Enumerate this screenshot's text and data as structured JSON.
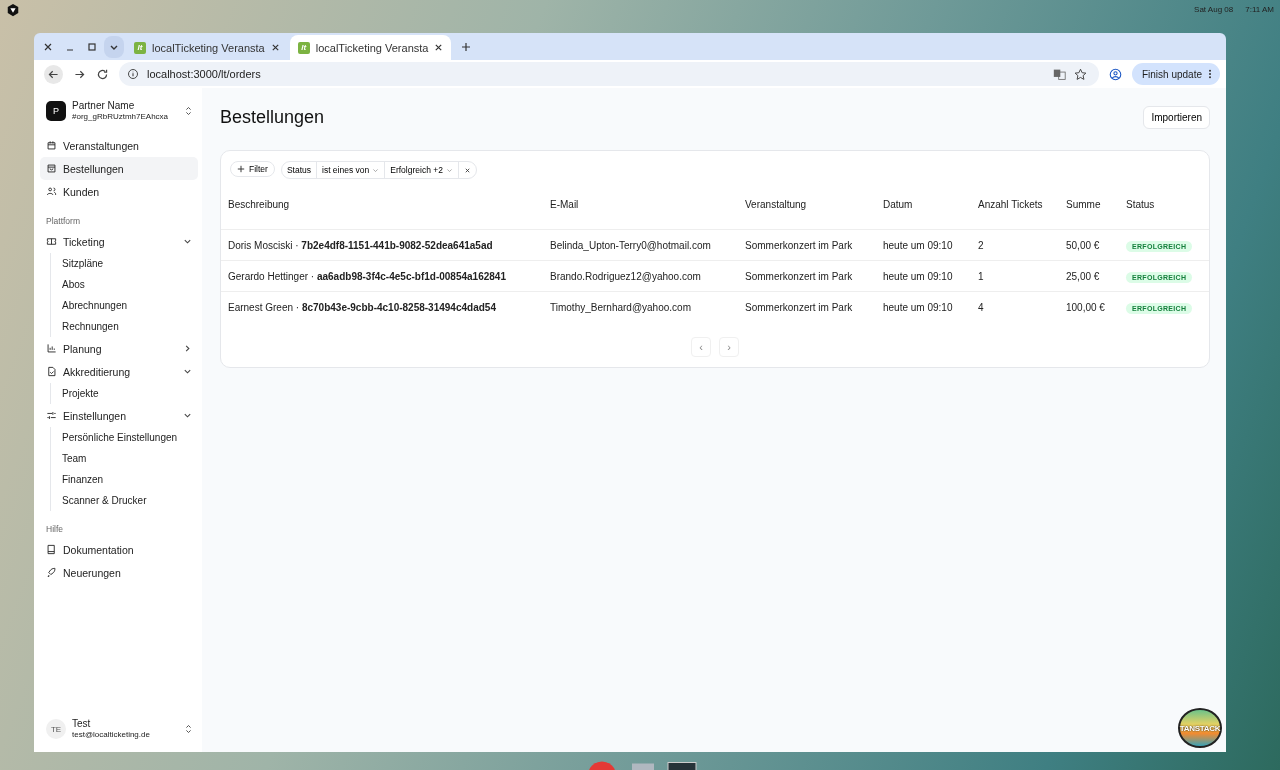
{
  "topbar": {
    "date": "Sat Aug 08",
    "time": "7:11 AM"
  },
  "browser": {
    "tabs": [
      {
        "title": "localTicketing Veransta",
        "favicon": "lt",
        "selected": false
      },
      {
        "title": "localTicketing Veransta",
        "favicon": "lt",
        "selected": true
      }
    ],
    "url": "localhost:3000/lt/orders",
    "update_button": "Finish update"
  },
  "sidebar": {
    "org": {
      "avatar": "P",
      "name": "Partner Name",
      "id": "#org_gRbRUztmh7EAhcxa"
    },
    "items": [
      {
        "label": "Veranstaltungen",
        "selected": false
      },
      {
        "label": "Bestellungen",
        "selected": true
      },
      {
        "label": "Kunden",
        "selected": false
      }
    ],
    "sections": [
      {
        "title": "Plattform",
        "groups": [
          {
            "label": "Ticketing",
            "expanded": true,
            "children": [
              {
                "label": "Sitzpläne"
              },
              {
                "label": "Abos"
              },
              {
                "label": "Abrechnungen"
              },
              {
                "label": "Rechnungen"
              }
            ]
          },
          {
            "label": "Planung",
            "expanded": false
          },
          {
            "label": "Akkreditierung",
            "expanded": true,
            "children": [
              {
                "label": "Projekte"
              }
            ]
          },
          {
            "label": "Einstellungen",
            "expanded": true,
            "children": [
              {
                "label": "Persönliche Einstellungen"
              },
              {
                "label": "Team"
              },
              {
                "label": "Finanzen"
              },
              {
                "label": "Scanner & Drucker"
              }
            ]
          }
        ]
      },
      {
        "title": "Hilfe",
        "groups": [
          {
            "label": "Dokumentation"
          },
          {
            "label": "Neuerungen"
          }
        ]
      }
    ],
    "user": {
      "initials": "TE",
      "name": "Test",
      "email": "test@localticketing.de"
    }
  },
  "page": {
    "title": "Bestellungen",
    "import_button": "Importieren",
    "filter": {
      "add": "Filter",
      "field": "Status",
      "operator": "ist eines von",
      "value": "Erfolgreich +2"
    },
    "table": {
      "columns": [
        "Beschreibung",
        "E-Mail",
        "Veranstaltung",
        "Datum",
        "Anzahl Tickets",
        "Summe",
        "Status"
      ],
      "rows": [
        {
          "description": "Doris Mosciski · **7b2e4df8-1151-441b-9082-52dea641a5ad**",
          "email": "Belinda_Upton-Terry0@hotmail.com",
          "event": "Sommerkonzert im Park",
          "date": "heute um 09:10",
          "tickets": "2",
          "sum": "50,00 €",
          "status": "ERFOLGREICH",
          "color": "#dcfce7"
        },
        {
          "description": "Gerardo Hettinger · **aa6adb98-3f4c-4e5c-bf1d-00854a162841**",
          "email": "Brando.Rodriguez12@yahoo.com",
          "event": "Sommerkonzert im Park",
          "date": "heute um 09:10",
          "tickets": "1",
          "sum": "25,00 €",
          "status": "ERFOLGREICH",
          "color": "#dcfce7"
        },
        {
          "description": "Earnest Green · **8c70b43e-9cbb-4c10-8258-31494c4dad54**",
          "email": "Timothy_Bernhard@yahoo.com",
          "event": "Sommerkonzert im Park",
          "date": "heute um 09:10",
          "tickets": "4",
          "sum": "100,00 €",
          "status": "ERFOLGREICH",
          "color": "#dcfce7"
        }
      ]
    },
    "pagination": {
      "prev": "‹",
      "next": "›"
    }
  },
  "devtools_badge": "TANSTACK"
}
